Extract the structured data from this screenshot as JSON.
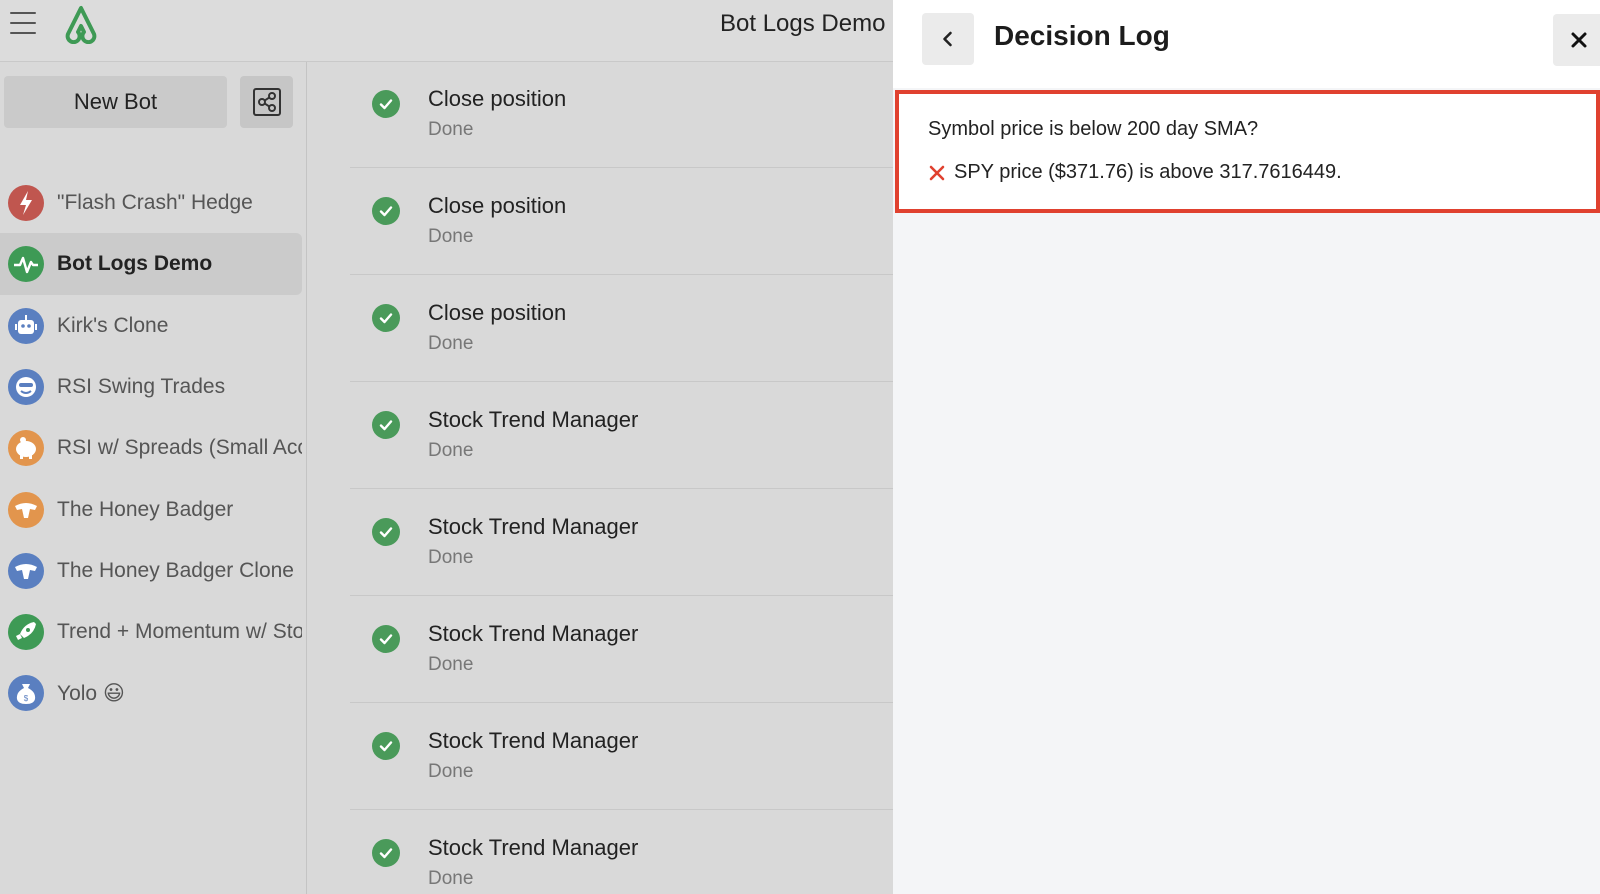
{
  "header": {
    "title": "Bot Logs Demo"
  },
  "sidebar": {
    "new_bot_label": "New Bot",
    "bots": [
      {
        "name": "\"Flash Crash\" Hedge",
        "icon": "bolt-icon",
        "color": "#c0564f"
      },
      {
        "name": "Bot Logs Demo",
        "icon": "pulse-icon",
        "color": "#3e9a55",
        "active": true
      },
      {
        "name": "Kirk's Clone",
        "icon": "robot-icon",
        "color": "#5a7fc0"
      },
      {
        "name": "RSI Swing Trades",
        "icon": "face-icon",
        "color": "#5a7fc0"
      },
      {
        "name": "RSI w/ Spreads (Small Account)",
        "icon": "piggy-bank-icon",
        "color": "#e2954d"
      },
      {
        "name": "The Honey Badger",
        "icon": "badger-icon",
        "color": "#e2954d"
      },
      {
        "name": "The Honey Badger Clone",
        "icon": "badger-icon",
        "color": "#5a7fc0"
      },
      {
        "name": "Trend + Momentum w/ Stops",
        "icon": "rocket-icon",
        "color": "#3e9a55"
      },
      {
        "name": "Yolo 😃",
        "icon": "money-bag-icon",
        "color": "#5a7fc0"
      }
    ]
  },
  "logs": [
    {
      "title": "Close position",
      "status": "Done"
    },
    {
      "title": "Close position",
      "status": "Done"
    },
    {
      "title": "Close position",
      "status": "Done"
    },
    {
      "title": "Stock Trend Manager",
      "status": "Done"
    },
    {
      "title": "Stock Trend Manager",
      "status": "Done"
    },
    {
      "title": "Stock Trend Manager",
      "status": "Done"
    },
    {
      "title": "Stock Trend Manager",
      "status": "Done"
    },
    {
      "title": "Stock Trend Manager",
      "status": "Done"
    }
  ],
  "panel": {
    "title": "Decision Log",
    "question": "Symbol price is below 200 day SMA?",
    "result": "SPY price ($371.76) is above 317.7616449.",
    "result_icon": "x-icon",
    "accent_color": "#e0412f",
    "success_color": "#4a9a5a"
  }
}
